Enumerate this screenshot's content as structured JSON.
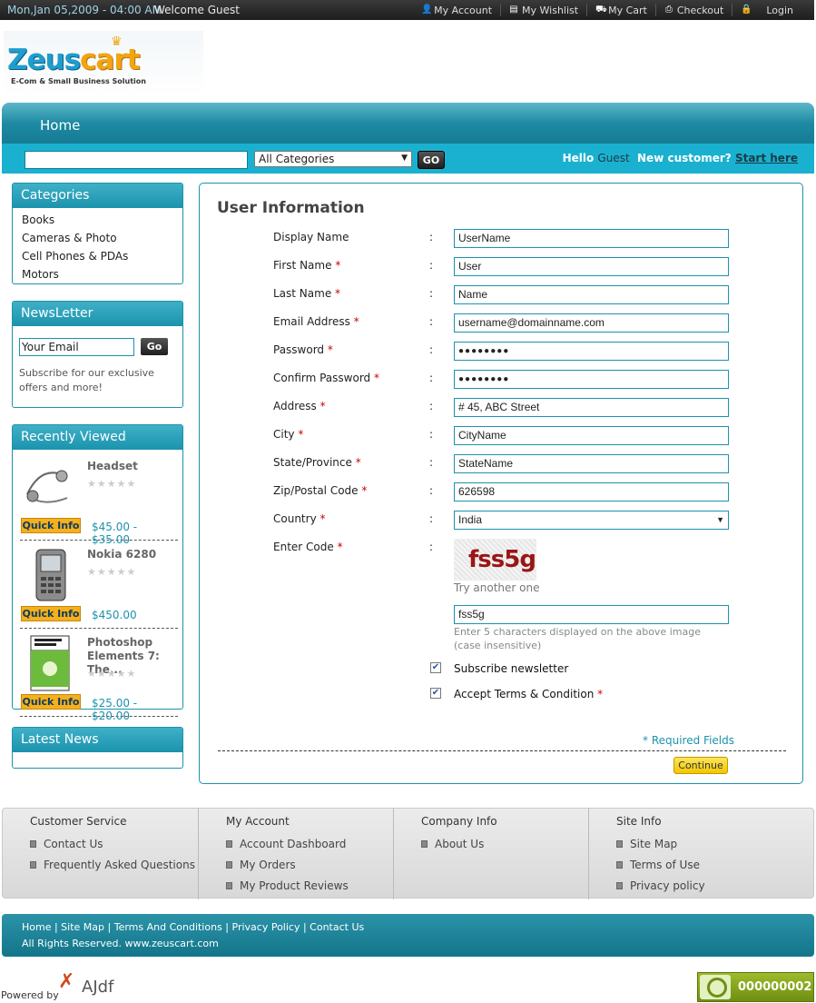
{
  "topbar": {
    "date": "Mon,Jan 05,2009 - 04:00 AM",
    "welcome": "Welcome Guest",
    "links": [
      {
        "label": "My Account"
      },
      {
        "label": "My Wishlist"
      },
      {
        "label": "My Cart"
      },
      {
        "label": "Checkout"
      },
      {
        "label": "Login"
      }
    ]
  },
  "logo": {
    "word1": "Zeus",
    "word2": "cart",
    "tagline": "E-Com & Small Business Solution"
  },
  "nav": {
    "home": "Home"
  },
  "search": {
    "placeholder": "",
    "category": "All Categories",
    "go": "GO"
  },
  "hello": {
    "hello": "Hello",
    "guest": "Guest",
    "new_customer": "New customer?",
    "start_here": " Start here"
  },
  "categories": {
    "title": "Categories",
    "items": [
      "Books",
      "Cameras & Photo",
      "Cell Phones & PDAs",
      "Motors"
    ]
  },
  "newsletter": {
    "title": "NewsLetter",
    "input_value": "Your Email",
    "go": "Go",
    "text": "Subscribe for our exclusive offers and more!"
  },
  "recently_viewed": {
    "title": "Recently Viewed",
    "items": [
      {
        "name": "Headset",
        "price": "$45.00 - $35.00",
        "quick_info": "Quick Info"
      },
      {
        "name": "Nokia 6280",
        "price": "$450.00",
        "quick_info": "Quick Info"
      },
      {
        "name": "Photoshop Elements 7: The...",
        "price": "$25.00 - $20.00",
        "quick_info": "Quick Info"
      }
    ]
  },
  "latest_news": {
    "title": "Latest News"
  },
  "form": {
    "title": "User Information",
    "fields": [
      {
        "label": "Display Name",
        "required": "",
        "value": "UserName"
      },
      {
        "label": "First Name",
        "required": "*",
        "value": "User"
      },
      {
        "label": "Last Name",
        "required": "*",
        "value": "Name"
      },
      {
        "label": "Email Address",
        "required": "*",
        "value": "username@domainname.com"
      },
      {
        "label": "Password",
        "required": "*",
        "value": "●●●●●●●●"
      },
      {
        "label": "Confirm Password",
        "required": "*",
        "value": "●●●●●●●●"
      },
      {
        "label": "Address",
        "required": "*",
        "value": "# 45, ABC Street"
      },
      {
        "label": "City",
        "required": "*",
        "value": "CityName"
      },
      {
        "label": "State/Province",
        "required": "*",
        "value": "StateName"
      },
      {
        "label": "Zip/Postal Code",
        "required": "*",
        "value": "626598"
      },
      {
        "label": "Country",
        "required": "*",
        "value": "India"
      },
      {
        "label": "Enter Code",
        "required": "*",
        "value": ""
      }
    ],
    "colon": ":",
    "captcha_text": "fss5g",
    "try_another": "Try another one",
    "code_value": "fss5g",
    "code_help_1": "Enter 5 characters displayed on the above image",
    "code_help_2": "(case insensitive)",
    "subscribe_label": "Subscribe newsletter",
    "terms_label": "Accept Terms & Condition",
    "terms_required": "*",
    "required_note": "* Required Fields",
    "continue": "Continue"
  },
  "footer": {
    "columns": [
      {
        "title": "Customer Service",
        "items": [
          "Contact Us",
          "Frequently Asked Questions"
        ]
      },
      {
        "title": "My Account",
        "items": [
          "Account Dashboard",
          "My Orders",
          "My Product Reviews"
        ]
      },
      {
        "title": "Company Info",
        "items": [
          "About Us"
        ]
      },
      {
        "title": "Site Info",
        "items": [
          "Site Map",
          "Terms of Use",
          "Privacy policy"
        ]
      }
    ],
    "bottom_links": "Home | Site Map | Terms And Conditions | Privacy Policy | Contact Us",
    "copyright": "All Rights Reserved. www.zeuscart.com",
    "powered_by": "Powered by",
    "ajdf": "AJdf",
    "counter": "000000002"
  },
  "colors": {
    "accent": "#1b93ad",
    "header_bar": "#1ab1d0",
    "button_yellow": "#f5b01c"
  }
}
